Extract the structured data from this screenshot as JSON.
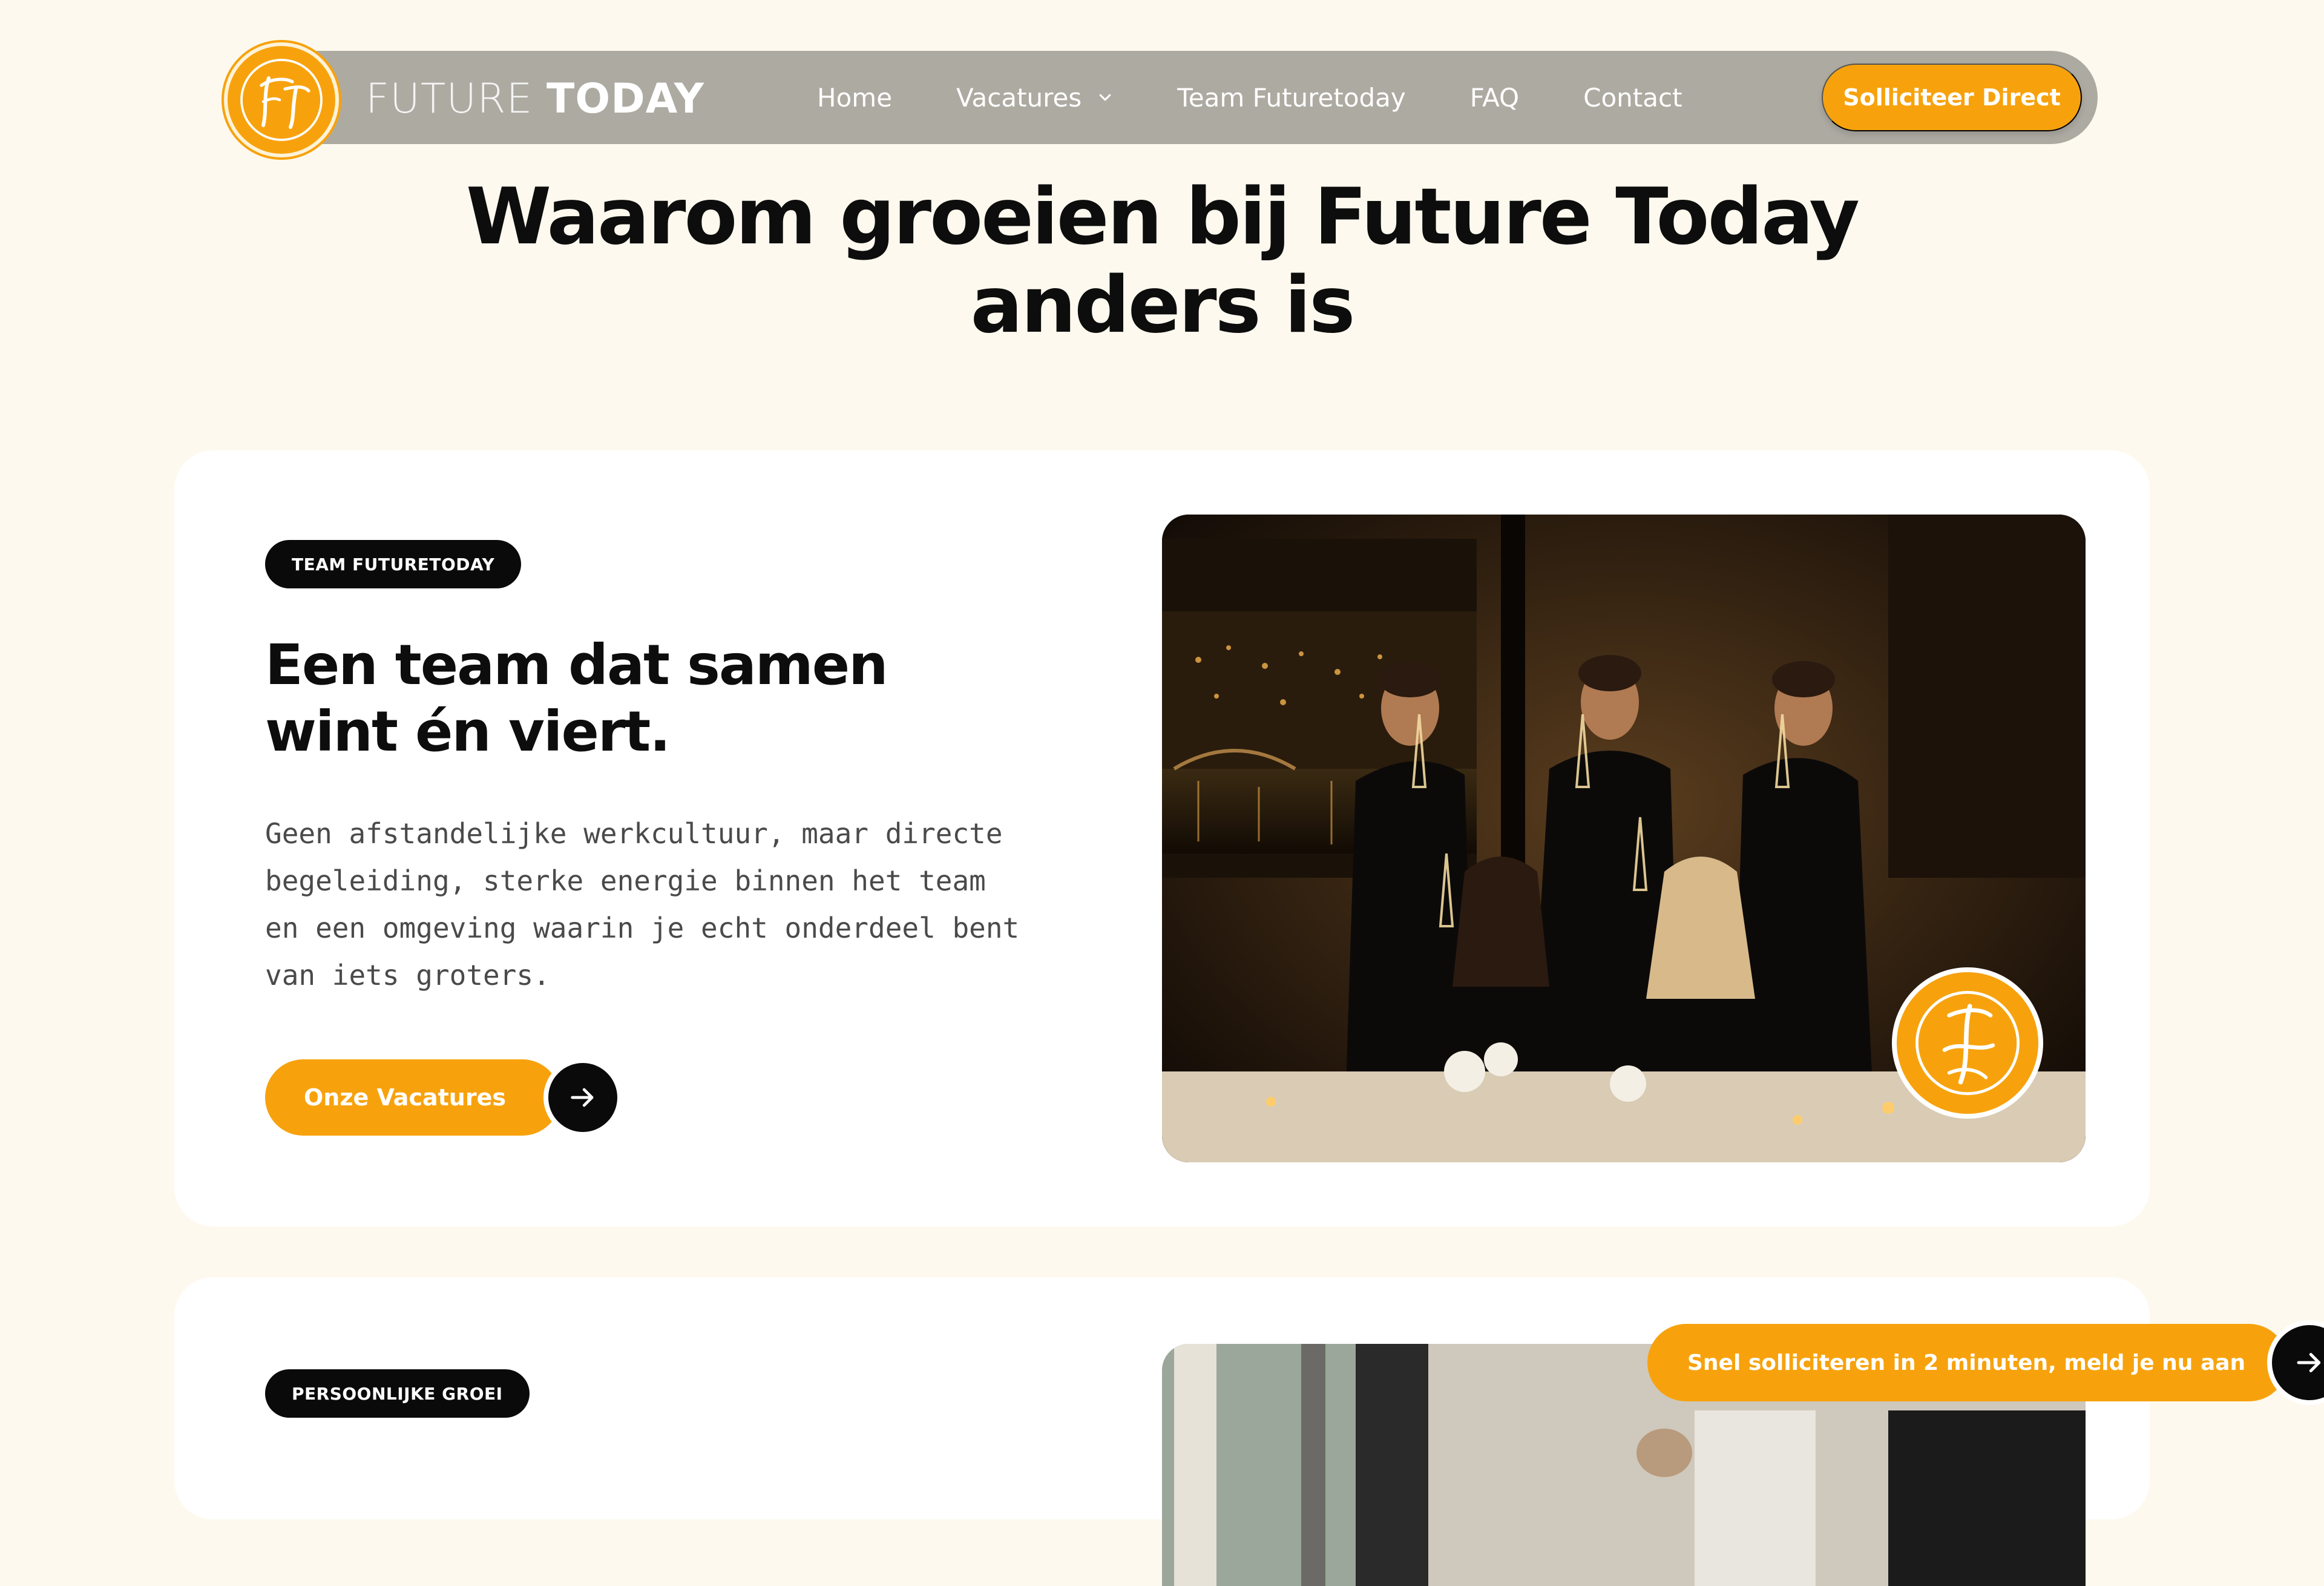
{
  "colors": {
    "accent": "#f7a20d",
    "nav_bg": "#adaaa2",
    "page_bg": "#fdf9ee",
    "dark": "#0a0a0a"
  },
  "header": {
    "logo_icon": "ft-monogram-icon",
    "brand_light": "FUTURE",
    "brand_bold": "TODAY",
    "nav": [
      {
        "label": "Home"
      },
      {
        "label": "Vacatures",
        "icon": "chevron-down-icon"
      },
      {
        "label": "Team Futuretoday"
      },
      {
        "label": "FAQ"
      },
      {
        "label": "Contact"
      }
    ],
    "cta_label": "Solliciteer Direct"
  },
  "hero": {
    "title_line1": "Waarom groeien bij Future Today",
    "title_line2": "anders is"
  },
  "card1": {
    "tag": "TEAM FUTURETODAY",
    "heading_line1": "Een team dat samen",
    "heading_line2": "wint én viert.",
    "body": "Geen afstandelijke werkcultuur, maar directe begeleiding, sterke energie binnen het team en een omgeving waarin je echt onderdeel bent van iets groters.",
    "button_label": "Onze Vacatures",
    "button_icon": "arrow-right-icon",
    "photo_badge_icon": "ft-monogram-icon"
  },
  "card2": {
    "tag": "PERSOONLIJKE GROEI"
  },
  "floating_cta": {
    "label": "Snel solliciteren in 2 minuten, meld je nu aan",
    "icon": "arrow-right-icon"
  }
}
